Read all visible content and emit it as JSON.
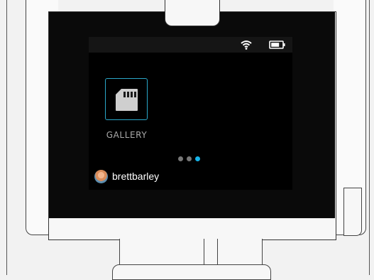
{
  "status": {
    "wifi_icon": "wifi-icon",
    "battery_icon": "battery-icon"
  },
  "apps": [
    {
      "label": "GALLERY",
      "icon": "sd-card-icon",
      "accent": "#2aa7c9"
    }
  ],
  "pager": {
    "count": 3,
    "active_index": 2,
    "active_color": "#16b4e9"
  },
  "user": {
    "username": "brettbarley"
  }
}
